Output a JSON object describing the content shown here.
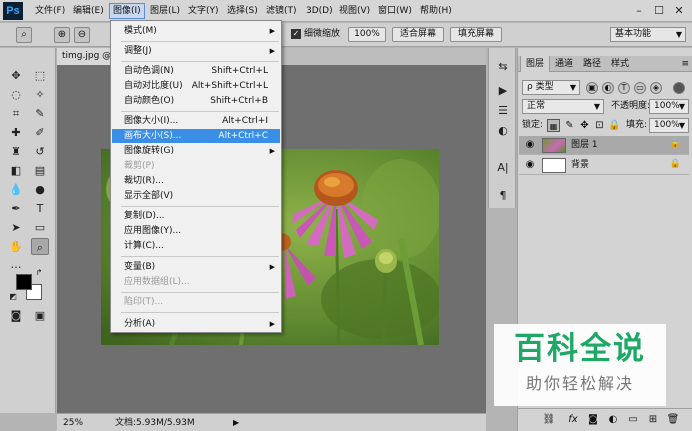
{
  "menubar": {
    "logo": "Ps",
    "items": [
      "文件(F)",
      "编辑(E)",
      "图像(I)",
      "图层(L)",
      "文字(Y)",
      "选择(S)",
      "滤镜(T)",
      "3D(D)",
      "视图(V)",
      "窗口(W)",
      "帮助(H)"
    ],
    "active_index": 2,
    "window_controls": [
      "–",
      "☐",
      "✕"
    ]
  },
  "options_bar": {
    "scrubby_zoom_checkbox_label": "细微缩放",
    "zoom_100_label": "100%",
    "fit_screen_label": "适合屏幕",
    "fill_screen_label": "填充屏幕",
    "workspace": "基本功能"
  },
  "document": {
    "tab_title": "timg.jpg @ 25% (",
    "status_zoom": "25%",
    "status_doc": "文档:5.93M/5.93M"
  },
  "image_menu": {
    "items": [
      {
        "label": "模式(M)",
        "shortcut": "",
        "submenu": true,
        "disabled": false,
        "highlighted": false
      },
      {
        "label": "调整(J)",
        "shortcut": "",
        "submenu": true,
        "disabled": false,
        "highlighted": false
      },
      {
        "label": "自动色调(N)",
        "shortcut": "Shift+Ctrl+L",
        "submenu": false,
        "disabled": false,
        "highlighted": false
      },
      {
        "label": "自动对比度(U)",
        "shortcut": "Alt+Shift+Ctrl+L",
        "submenu": false,
        "disabled": false,
        "highlighted": false
      },
      {
        "label": "自动颜色(O)",
        "shortcut": "Shift+Ctrl+B",
        "submenu": false,
        "disabled": false,
        "highlighted": false
      },
      {
        "label": "图像大小(I)...",
        "shortcut": "Alt+Ctrl+I",
        "submenu": false,
        "disabled": false,
        "highlighted": false
      },
      {
        "label": "画布大小(S)...",
        "shortcut": "Alt+Ctrl+C",
        "submenu": false,
        "disabled": false,
        "highlighted": true
      },
      {
        "label": "图像旋转(G)",
        "shortcut": "",
        "submenu": true,
        "disabled": false,
        "highlighted": false
      },
      {
        "label": "裁剪(P)",
        "shortcut": "",
        "submenu": false,
        "disabled": true,
        "highlighted": false
      },
      {
        "label": "裁切(R)...",
        "shortcut": "",
        "submenu": false,
        "disabled": false,
        "highlighted": false
      },
      {
        "label": "显示全部(V)",
        "shortcut": "",
        "submenu": false,
        "disabled": false,
        "highlighted": false
      },
      {
        "label": "复制(D)...",
        "shortcut": "",
        "submenu": false,
        "disabled": false,
        "highlighted": false
      },
      {
        "label": "应用图像(Y)...",
        "shortcut": "",
        "submenu": false,
        "disabled": false,
        "highlighted": false
      },
      {
        "label": "计算(C)...",
        "shortcut": "",
        "submenu": false,
        "disabled": false,
        "highlighted": false
      },
      {
        "label": "变量(B)",
        "shortcut": "",
        "submenu": true,
        "disabled": false,
        "highlighted": false
      },
      {
        "label": "应用数据组(L)...",
        "shortcut": "",
        "submenu": false,
        "disabled": true,
        "highlighted": false
      },
      {
        "label": "陷印(T)...",
        "shortcut": "",
        "submenu": false,
        "disabled": true,
        "highlighted": false
      },
      {
        "label": "分析(A)",
        "shortcut": "",
        "submenu": true,
        "disabled": false,
        "highlighted": false
      }
    ]
  },
  "layers_panel": {
    "tabs": [
      "图层",
      "通道",
      "路径",
      "样式"
    ],
    "filter_label": "ρ 类型",
    "blend_mode": "正常",
    "opacity_label": "不透明度:",
    "opacity_value": "100%",
    "lock_label": "锁定:",
    "fill_label": "填充:",
    "fill_value": "100%",
    "layers": [
      {
        "name": "图层 1",
        "selected": true
      },
      {
        "name": "背景",
        "selected": false
      }
    ]
  },
  "watermark": {
    "title": "百科全说",
    "subtitle": "助你轻松解决"
  },
  "colors": {
    "menu_highlight": "#3a8ee6",
    "watermark_green": "#1ea866",
    "canvas_bg": "#6f6f6f"
  }
}
